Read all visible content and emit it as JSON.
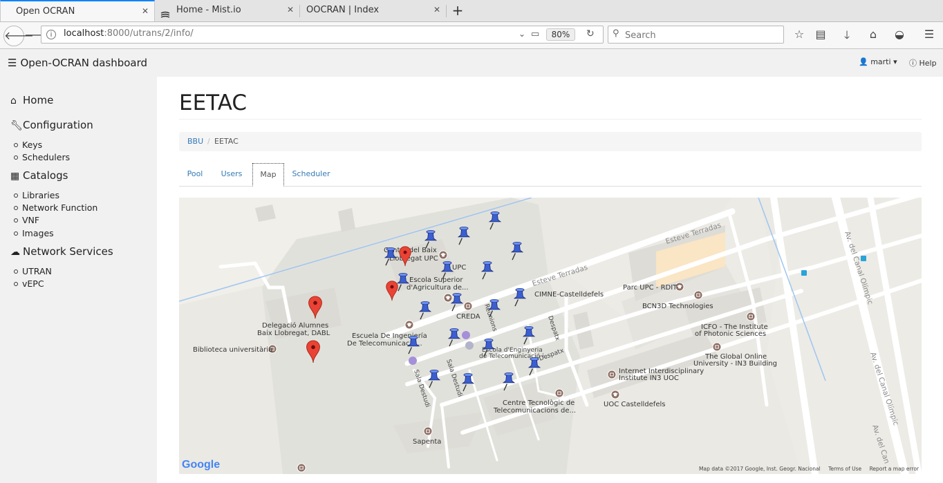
{
  "browser": {
    "tabs": [
      {
        "title": "Open OCRAN",
        "active": true
      },
      {
        "title": "Home - Mist.io",
        "active": false
      },
      {
        "title": "OOCRAN | Index",
        "active": false
      }
    ],
    "url_host": "localhost",
    "url_path": ":8000/utrans/2/info/",
    "zoom": "80%",
    "search_placeholder": "Search"
  },
  "header": {
    "brand": "Open-OCRAN dashboard",
    "user": "marti",
    "help": "Help"
  },
  "sidebar": {
    "home": "Home",
    "configuration": "Configuration",
    "config_items": [
      "Keys",
      "Schedulers"
    ],
    "catalogs": "Catalogs",
    "catalog_items": [
      "Libraries",
      "Network Function",
      "VNF",
      "Images"
    ],
    "network_services": "Network Services",
    "ns_items": [
      "UTRAN",
      "vEPC"
    ]
  },
  "main": {
    "title": "EETAC",
    "breadcrumb": {
      "link": "BBU",
      "current": "EETAC"
    },
    "tabs": [
      "Pool",
      "Users",
      "Map",
      "Scheduler"
    ],
    "active_tab": "Map"
  },
  "map": {
    "labels": {
      "centre_baix": "Centre del Baix",
      "llobregat_upc": "Llobregat UPC",
      "upc": "UPC",
      "escola_superior": "Escola Superior",
      "agricultura": "d'Agricultura de...",
      "esteve1": "Esteve Terradas",
      "esteve2": "Esteve Terradas",
      "cimne": "CIMNE-Castelldefels",
      "parc_upc": "Parc UPC - RDIT",
      "bcn3d": "BCN3D Technologies",
      "creda": "CREDA",
      "reunions": "Reunions",
      "despatx1": "Despatx",
      "despatx2": "Despatx",
      "delegacio1": "Delegació Alumnes",
      "delegacio2": "Baix Llobregat, DABL",
      "escuela1": "Escuela De Ingeniería",
      "escuela2": "De Telecomunicació...",
      "biblioteca": "Biblioteca universitària",
      "escola_eng1": "Escola d'Enginyeria",
      "escola_eng2": "de Telecomunicació i...",
      "sala1": "Sala Destudi",
      "sala2": "Sala Destudi",
      "icfo1": "ICFO - The Institute",
      "icfo2": "of Photonic Sciences",
      "global1": "The Global Online",
      "global2": "University - IN3 Building",
      "in3_1": "Internet Interdisciplinary",
      "in3_2": "Institute IN3 UOC",
      "uoc": "UOC Castelldefels",
      "centre_tec1": "Centre Tecnològic de",
      "centre_tec2": "Telecomunicacions de...",
      "sapenta": "Sapenta",
      "canal1": "Av. del Canal Olímpic",
      "canal2": "Av. del Canal Olímpic",
      "canal3": "Av. del Can"
    },
    "logo": "Google",
    "attribution": "Map data ©2017 Google, Inst. Geogr. Nacional",
    "terms": "Terms of Use",
    "report": "Report a map error",
    "marker_counts": {
      "red": 4,
      "blue": 25
    },
    "colors": {
      "red_marker": "#ea4335",
      "blue_pin": "#3b5fcf",
      "poi": "#8d6e63"
    }
  }
}
